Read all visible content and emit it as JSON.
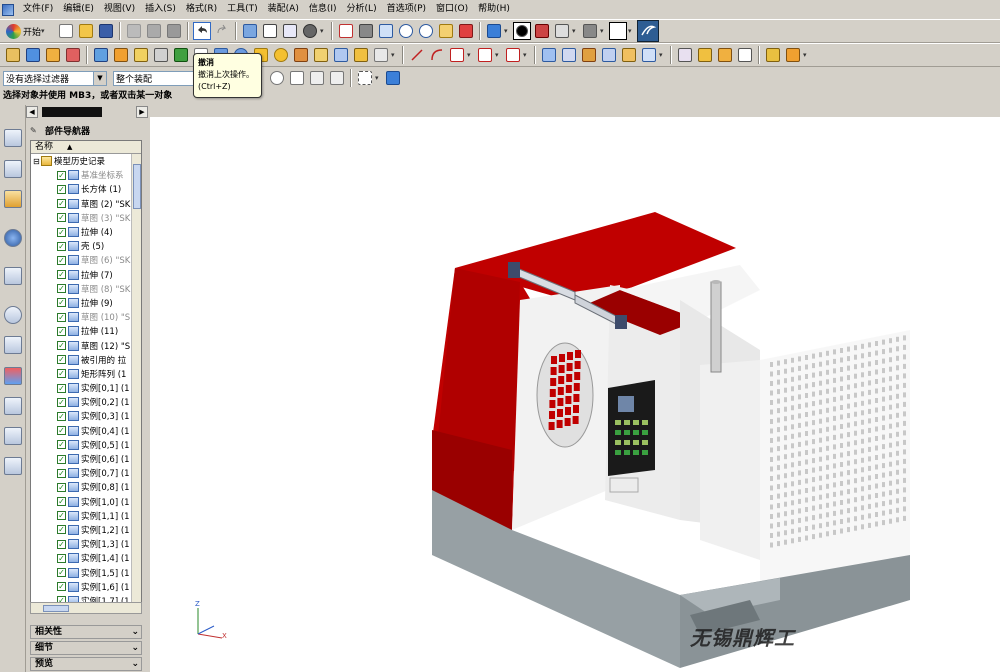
{
  "menu": [
    "文件(F)",
    "编辑(E)",
    "视图(V)",
    "插入(S)",
    "格式(R)",
    "工具(T)",
    "装配(A)",
    "信息(I)",
    "分析(L)",
    "首选项(P)",
    "窗口(O)",
    "帮助(H)"
  ],
  "toolbar": {
    "start_label": "开始"
  },
  "filter": {
    "selection_filter": "没有选择过滤器",
    "assembly_scope": "整个装配"
  },
  "status_text": "选择对象并使用 MB3，或者双击某一对象",
  "tooltip": {
    "title": "撤消",
    "desc": "撤消上次操作。",
    "shortcut": "(Ctrl+Z)"
  },
  "navigator": {
    "title": "部件导航器",
    "column_name": "名称",
    "root": "模型历史记录",
    "items": [
      {
        "label": "基准坐标系",
        "state": "grey"
      },
      {
        "label": "长方体 (1)",
        "state": "normal"
      },
      {
        "label": "草图 (2) \"SK",
        "state": "normal"
      },
      {
        "label": "草图 (3) \"SK",
        "state": "grey"
      },
      {
        "label": "拉伸 (4)",
        "state": "normal"
      },
      {
        "label": "壳 (5)",
        "state": "normal"
      },
      {
        "label": "草图 (6) \"SK",
        "state": "grey"
      },
      {
        "label": "拉伸 (7)",
        "state": "normal"
      },
      {
        "label": "草图 (8) \"SK",
        "state": "grey"
      },
      {
        "label": "拉伸 (9)",
        "state": "normal"
      },
      {
        "label": "草图 (10) \"S",
        "state": "grey"
      },
      {
        "label": "拉伸 (11)",
        "state": "normal"
      },
      {
        "label": "草图 (12) \"S",
        "state": "normal"
      },
      {
        "label": "被引用的 拉",
        "state": "normal"
      },
      {
        "label": "矩形阵列 (1",
        "state": "normal"
      },
      {
        "label": "实例[0,1] (1",
        "state": "normal"
      },
      {
        "label": "实例[0,2] (1",
        "state": "normal"
      },
      {
        "label": "实例[0,3] (1",
        "state": "normal"
      },
      {
        "label": "实例[0,4] (1",
        "state": "normal"
      },
      {
        "label": "实例[0,5] (1",
        "state": "normal"
      },
      {
        "label": "实例[0,6] (1",
        "state": "normal"
      },
      {
        "label": "实例[0,7] (1",
        "state": "normal"
      },
      {
        "label": "实例[0,8] (1",
        "state": "normal"
      },
      {
        "label": "实例[1,0] (1",
        "state": "normal"
      },
      {
        "label": "实例[1,1] (1",
        "state": "normal"
      },
      {
        "label": "实例[1,2] (1",
        "state": "normal"
      },
      {
        "label": "实例[1,3] (1",
        "state": "normal"
      },
      {
        "label": "实例[1,4] (1",
        "state": "normal"
      },
      {
        "label": "实例[1,5] (1",
        "state": "normal"
      },
      {
        "label": "实例[1,6] (1",
        "state": "normal"
      },
      {
        "label": "实例[1,7] (1",
        "state": "normal"
      }
    ],
    "sections": [
      "相关性",
      "细节",
      "预览"
    ]
  },
  "axis_labels": {
    "z": "Z",
    "x": "X"
  },
  "watermark": "无锡鼎辉工",
  "colors": {
    "red": "#c00000",
    "body": "#f0f0f0",
    "base": "#97a0a4",
    "accent": "#2a6cc8"
  }
}
